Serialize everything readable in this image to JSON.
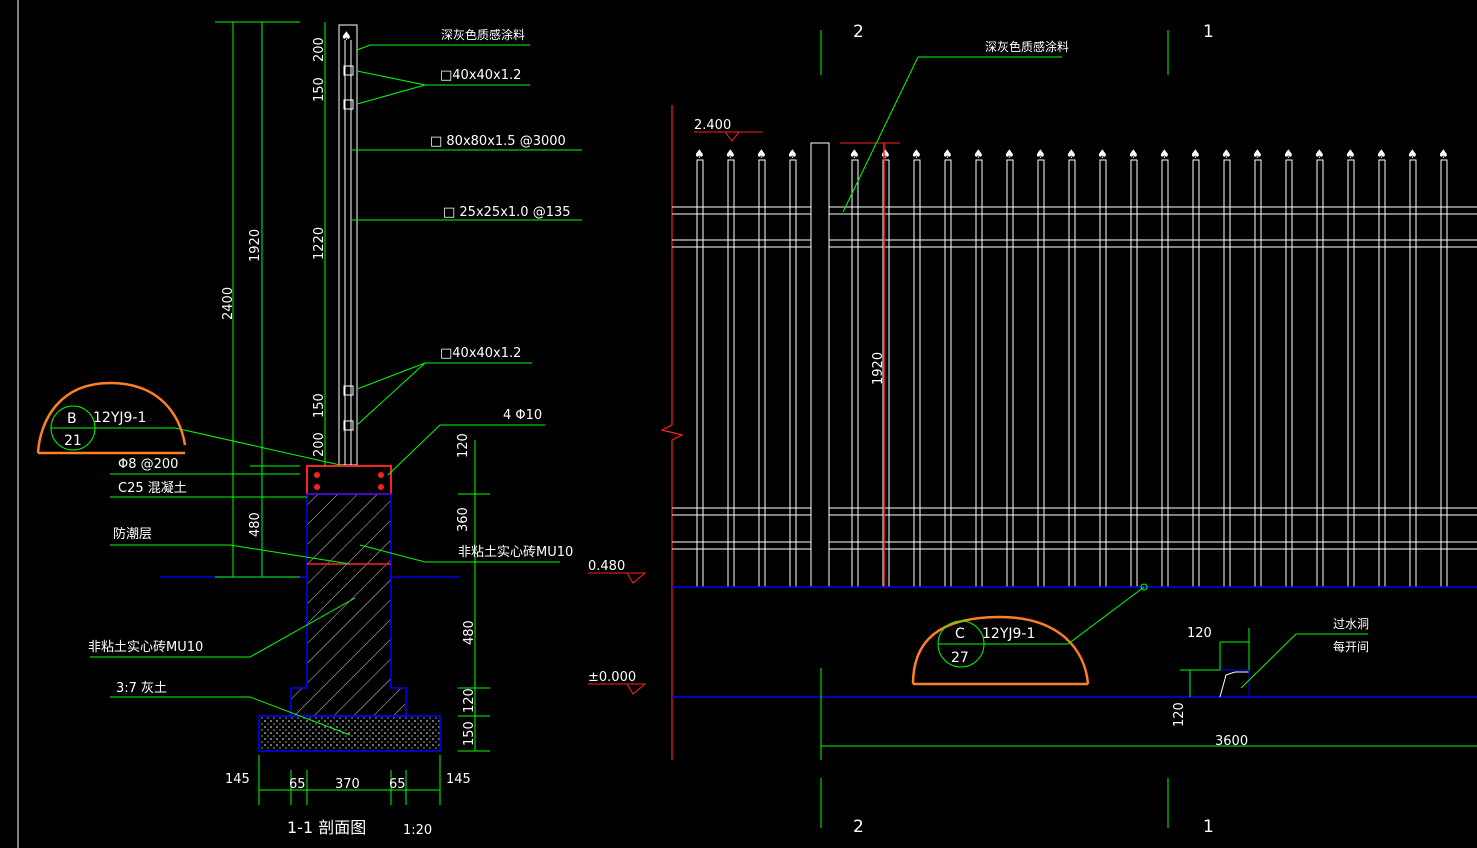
{
  "section": {
    "title": "1-1 剖面图",
    "scale": "1:20",
    "callout_b": {
      "letter": "B",
      "sheet": "12YJ9-1",
      "num": "21"
    },
    "labels": {
      "coating": "深灰色质感涂料",
      "rail_top1": "□40x40x1.2",
      "post": "□ 80x80x1.5 @3000",
      "picket": "□ 25x25x1.0 @135",
      "rail_top2": "□40x40x1.2",
      "rebar_main": "4 Φ10",
      "stirrup": "Φ8 @200",
      "concrete": "C25 混凝土",
      "damp": "防潮层",
      "brick_upper": "非粘土实心砖MU10",
      "brick_lower": "非粘土实心砖MU10",
      "lime": "3:7 灰土"
    },
    "dims": {
      "d2400": "2400",
      "d1920": "1920",
      "d480": "480",
      "p200a": "200",
      "p150a": "150",
      "p1220": "1220",
      "p150b": "150",
      "p200b": "200",
      "r120": "120",
      "r360": "360",
      "r480": "480",
      "r120b": "120",
      "r150": "150",
      "b145l": "145",
      "b65l": "65",
      "b370": "370",
      "b65r": "65",
      "b145r": "145"
    }
  },
  "elevation": {
    "coating": "深灰色质感涂料",
    "level_top": "2.400",
    "level_mid": "0.480",
    "level_zero": "±0.000",
    "height": "1920",
    "axis_left": "2",
    "axis_right": "1",
    "callout_c": {
      "letter": "C",
      "sheet": "12YJ9-1",
      "num": "27"
    },
    "opening_width": "120",
    "opening_height": "120",
    "opening_note1": "过水洞",
    "opening_note2": "每开间",
    "span": "3600",
    "colors": {
      "green": "#00ff00",
      "white": "#ffffff",
      "blue": "#0000ff",
      "red": "#ff2020",
      "orange": "#ff7f27"
    }
  }
}
